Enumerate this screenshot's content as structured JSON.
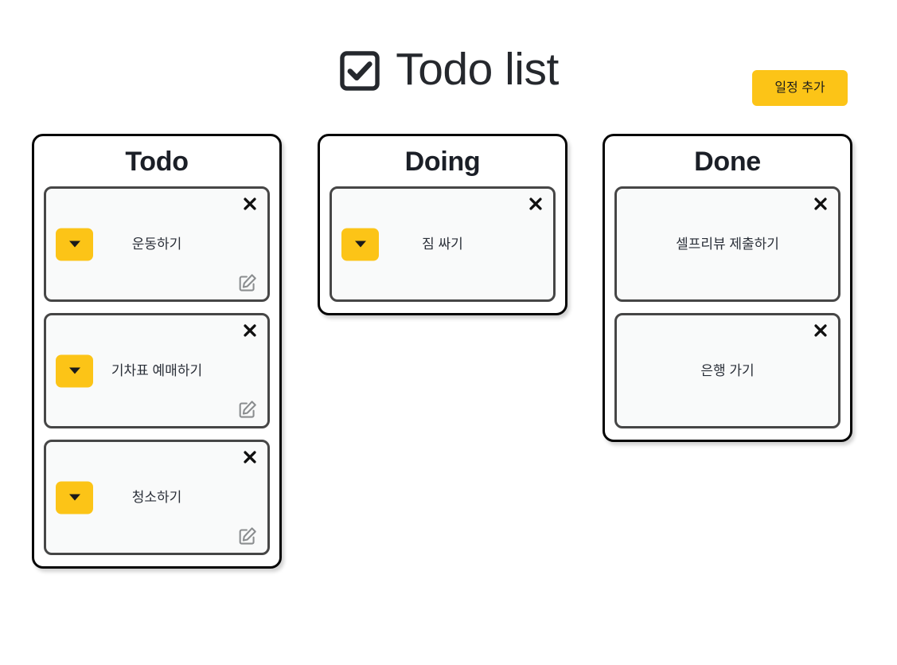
{
  "header": {
    "title": "Todo list",
    "title_icon": "checkbox-checked-icon",
    "add_button_label": "일정 추가"
  },
  "theme": {
    "accent": "#fcc417",
    "column_border": "#050505",
    "card_border": "#464646",
    "card_fill": "#f9fafa",
    "text": "#2a2f38",
    "page_background": "#ffffff"
  },
  "icons": {
    "close": "close-x-icon",
    "edit": "edit-pencil-square-icon",
    "dropdown": "chevron-down-icon"
  },
  "board": {
    "columns": [
      {
        "id": "todo",
        "title": "Todo",
        "cards": [
          {
            "text": "운동하기",
            "has_dropdown": true,
            "has_edit": true,
            "has_close": true
          },
          {
            "text": "기차표 예매하기",
            "has_dropdown": true,
            "has_edit": true,
            "has_close": true
          },
          {
            "text": "청소하기",
            "has_dropdown": true,
            "has_edit": true,
            "has_close": true
          }
        ]
      },
      {
        "id": "doing",
        "title": "Doing",
        "cards": [
          {
            "text": "짐 싸기",
            "has_dropdown": true,
            "has_edit": false,
            "has_close": true
          }
        ]
      },
      {
        "id": "done",
        "title": "Done",
        "cards": [
          {
            "text": "셀프리뷰 제출하기",
            "has_dropdown": false,
            "has_edit": false,
            "has_close": true
          },
          {
            "text": "은행 가기",
            "has_dropdown": false,
            "has_edit": false,
            "has_close": true
          }
        ]
      }
    ]
  }
}
